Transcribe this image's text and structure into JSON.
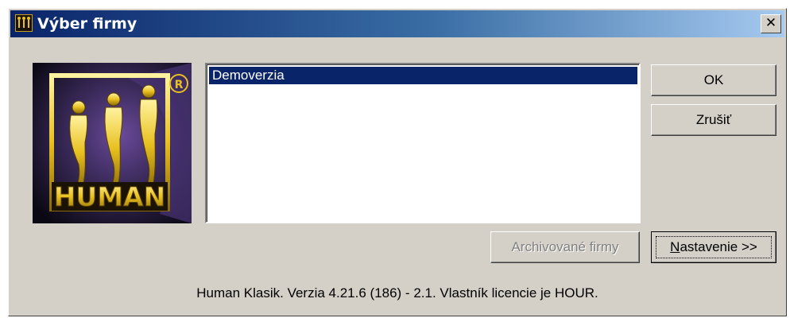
{
  "window": {
    "title": "Výber firmy",
    "close_glyph": "✕"
  },
  "logo": {
    "text": "HUMAN",
    "registered": "®"
  },
  "company_list": {
    "items": [
      "Demoverzia"
    ],
    "selected_index": 0
  },
  "buttons": {
    "ok": "OK",
    "cancel": "Zrušiť",
    "archive": "Archivované firmy",
    "settings_mnemonic": "N",
    "settings_rest": "astavenie >>"
  },
  "status_text": "Human Klasik. Verzia 4.21.6 (186) - 2.1. Vlastník licencie je HOUR.",
  "colors": {
    "titlebar_start": "#0a246a",
    "titlebar_end": "#a6caf0",
    "dialog_face": "#d4d0c8",
    "selection": "#0a246a",
    "logo_gold": "#e8c020",
    "logo_purple": "#5a3a8a"
  }
}
